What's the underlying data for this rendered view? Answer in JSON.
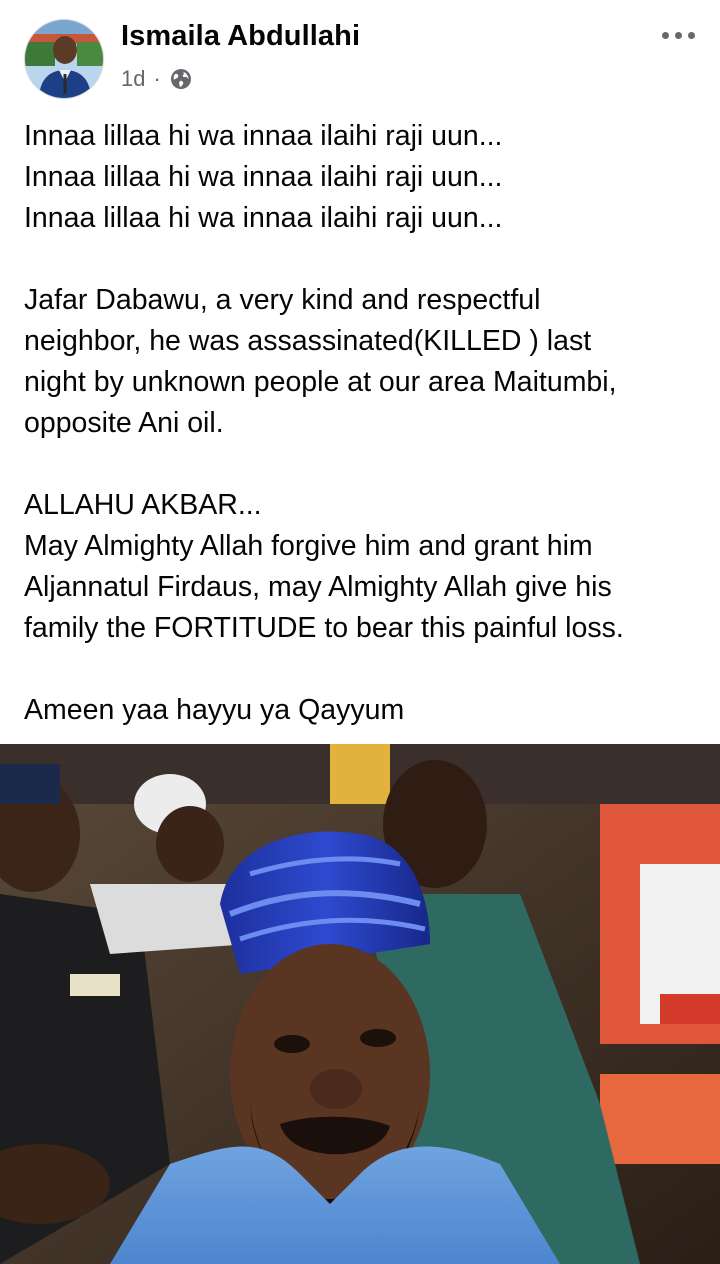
{
  "author": {
    "name": "Ismaila Abdullahi",
    "time": "1d",
    "separator": "·",
    "audience_icon": "globe-icon",
    "avatar_icon": "avatar-photo"
  },
  "menu": {
    "icon": "more-options-icon"
  },
  "post": {
    "lines": [
      "Innaa lillaa hi wa innaa ilaihi raji uun...",
      "Innaa lillaa hi wa innaa ilaihi raji uun...",
      "Innaa lillaa hi wa innaa ilaihi raji uun...",
      "",
      "Jafar Dabawu, a very kind and respectful",
      "neighbor, he was assassinated(KILLED ) last",
      "night by unknown people at our area Maitumbi,",
      "opposite Ani oil.",
      "",
      "ALLAHU AKBAR...",
      "May Almighty Allah forgive him and grant him",
      "Aljannatul Firdaus, may Almighty Allah give his",
      "family the FORTITUDE to bear this painful loss.",
      "",
      "Ameen yaa hayyu ya Qayyum"
    ]
  },
  "photo": {
    "icon": "post-photo"
  },
  "colors": {
    "text": "#050505",
    "secondary": "#65676b",
    "background": "#ffffff"
  }
}
